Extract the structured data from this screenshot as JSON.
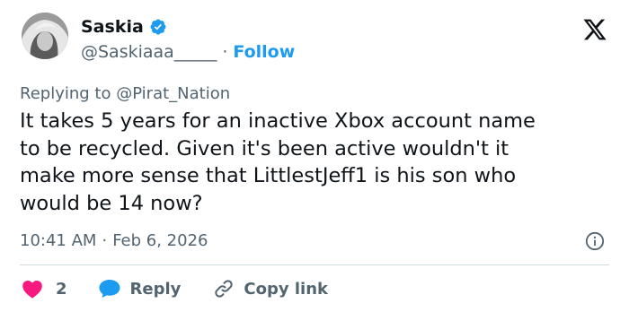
{
  "author": {
    "display_name": "Saskia",
    "handle": "@Saskiaaa_____",
    "separator": "·",
    "follow_label": "Follow",
    "verified_color": "#1d9bf0"
  },
  "reply_context": {
    "prefix": "Replying to",
    "mention": "@Pirat_Nation"
  },
  "tweet": {
    "lines": [
      "It takes 5 years for an inactive Xbox account name",
      "to be recycled. Given it's been active wouldn't it",
      "make more sense that LittlestJeff1 is his son who",
      "would be 14 now?"
    ],
    "time": "10:41 AM",
    "separator": "·",
    "date": "Feb 6, 2026"
  },
  "actions": {
    "like_count": "2",
    "reply_label": "Reply",
    "copy_label": "Copy link"
  },
  "icons": {
    "brand": "x-logo-icon",
    "verified": "verified-badge-icon",
    "info": "info-icon",
    "like": "heart-icon",
    "reply": "speech-bubble-icon",
    "copy": "link-icon"
  },
  "colors": {
    "text": "#0f1419",
    "secondary": "#536471",
    "accent": "#1d9bf0",
    "like": "#f91880",
    "divider": "#cfd9de"
  }
}
